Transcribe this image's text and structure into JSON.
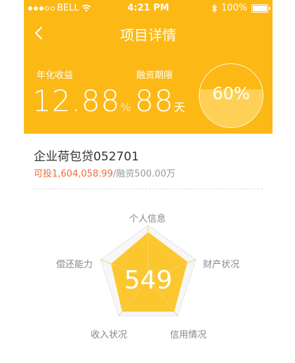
{
  "status_bar": {
    "carrier": "BELL",
    "time": "4:21 PM",
    "battery": "100%"
  },
  "nav": {
    "title": "项目详情"
  },
  "stats": {
    "rate_label": "年化收益",
    "rate_value": "12.88",
    "rate_unit": "%",
    "period_label": "融资期限",
    "period_value": "88",
    "period_unit": "天",
    "progress_text": "60%",
    "progress_fraction": 0.6
  },
  "project": {
    "name": "企业荷包贷052701",
    "investable": "可投1,604,058.99",
    "financing": "/融资500.00万"
  },
  "radar": {
    "labels": {
      "personal_info": "个人信息",
      "property_status": "财产状况",
      "credit_status": "信用情况",
      "income_status": "收入状况",
      "repay_ability": "偿还能力"
    },
    "score": "549"
  },
  "colors": {
    "brand": "#fcb814",
    "accent_red": "#f36c3c"
  }
}
